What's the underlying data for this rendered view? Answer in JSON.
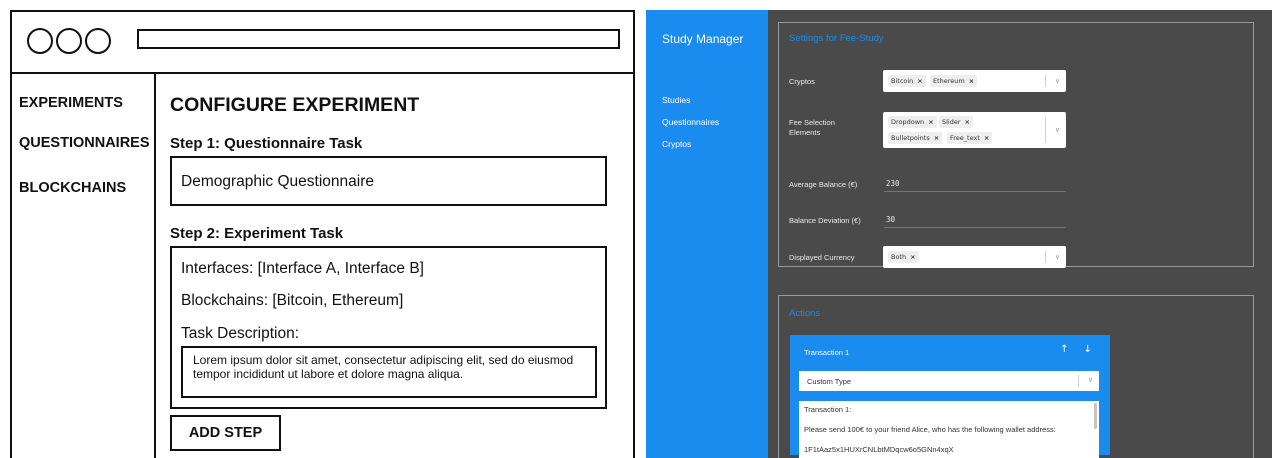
{
  "wireframe": {
    "nav": [
      "EXPERIMENTS",
      "QUESTIONNAIRES",
      "BLOCKCHAINS"
    ],
    "title": "CONFIGURE EXPERIMENT",
    "step1": {
      "label": "Step 1: Questionnaire Task",
      "value": "Demographic Questionnaire"
    },
    "step2": {
      "label": "Step 2: Experiment Task",
      "interfaces": "Interfaces: [Interface A, Interface B]",
      "blockchains": "Blockchains: [Bitcoin, Ethereum]",
      "task_label": "Task Description:",
      "task_text": "Lorem ipsum dolor sit amet, consectetur adipiscing elit, sed do eiusmod tempor incididunt ut labore et dolore magna aliqua."
    },
    "add_step": "ADD STEP"
  },
  "app": {
    "brand": "Study Manager",
    "nav": [
      "Studies",
      "Questionnaires",
      "Cryptos"
    ],
    "settings": {
      "title": "Settings for Fee-Study",
      "cryptos_label": "Cryptos",
      "cryptos": [
        "Bitcoin",
        "Ethereum"
      ],
      "fee_label_1": "Fee Selection",
      "fee_label_2": "Elements",
      "fee_elements": [
        "Dropdown",
        "Slider",
        "Bulletpoints",
        "Free_text"
      ],
      "avg_label": "Average Balance (€)",
      "avg_value": "230",
      "dev_label": "Balance Deviation (€)",
      "dev_value": "30",
      "currency_label": "Displayed Currency",
      "currency": [
        "Both"
      ],
      "remove_glyph": "×",
      "chevron": "∨"
    },
    "actions": {
      "title": "Actions",
      "tx_title": "Transaction 1",
      "arrows": "↑ ↓",
      "type": "Custom Type",
      "chevron": "∨",
      "lines": [
        "Transaction 1:",
        "Please send 100€ to your friend Alice, who has the following wallet address:",
        "1F1tAaz5x1HUXrCNLbtMDqcw6o5GNn4xqX"
      ]
    }
  },
  "colors": {
    "accent": "#1a8cf0",
    "app_bg": "#4a4a4a",
    "line": "#111111"
  }
}
